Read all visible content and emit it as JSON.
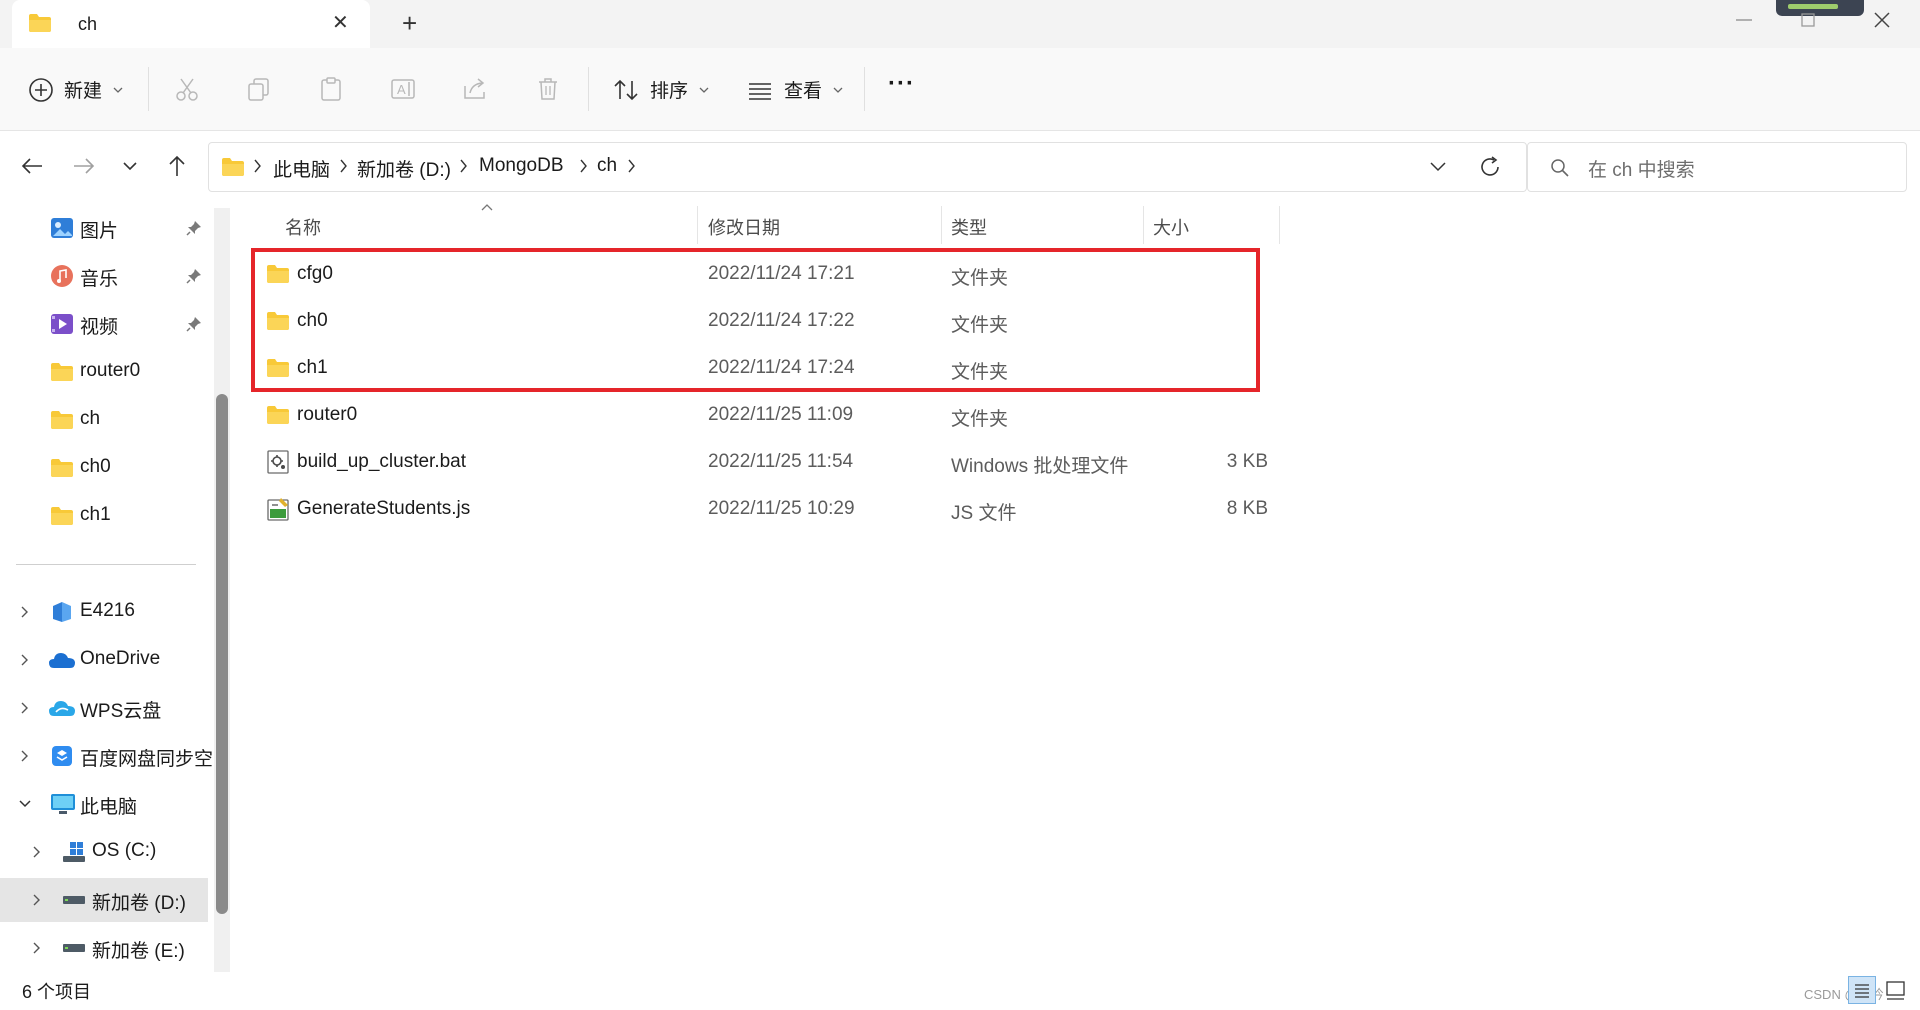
{
  "window": {
    "tab_title": "ch",
    "new_tab_symbol": "+",
    "close_tab_symbol": "✕"
  },
  "toolbar": {
    "new_label": "新建",
    "sort_label": "排序",
    "view_label": "查看",
    "more_label": "···"
  },
  "address": {
    "crumbs": [
      "此电脑",
      "新加卷 (D:)",
      "MongoDB",
      "ch"
    ]
  },
  "search": {
    "placeholder": "在 ch 中搜索"
  },
  "nav": {
    "quick": [
      {
        "label": "图片",
        "icon": "pictures-icon",
        "pinned": true
      },
      {
        "label": "音乐",
        "icon": "music-icon",
        "pinned": true
      },
      {
        "label": "视频",
        "icon": "videos-icon",
        "pinned": true
      },
      {
        "label": "router0",
        "icon": "folder-icon",
        "pinned": false
      },
      {
        "label": "ch",
        "icon": "folder-icon",
        "pinned": false
      },
      {
        "label": "ch0",
        "icon": "folder-icon",
        "pinned": false
      },
      {
        "label": "ch1",
        "icon": "folder-icon",
        "pinned": false
      }
    ],
    "tree": [
      {
        "label": "E4216",
        "icon": "cloud-folder-icon"
      },
      {
        "label": "OneDrive",
        "icon": "onedrive-icon"
      },
      {
        "label": "WPS云盘",
        "icon": "wps-cloud-icon"
      },
      {
        "label": "百度网盘同步空",
        "icon": "baidu-netdisk-icon"
      },
      {
        "label": "此电脑",
        "icon": "this-pc-icon"
      },
      {
        "label": "OS (C:)",
        "icon": "windows-drive-icon"
      },
      {
        "label": "新加卷 (D:)",
        "icon": "drive-icon"
      },
      {
        "label": "新加卷 (E:)",
        "icon": "drive-icon"
      }
    ]
  },
  "columns": {
    "name": "名称",
    "modified": "修改日期",
    "type": "类型",
    "size": "大小"
  },
  "files": [
    {
      "name": "cfg0",
      "modified": "2022/11/24 17:21",
      "type": "文件夹",
      "size": "",
      "icon": "folder-icon"
    },
    {
      "name": "ch0",
      "modified": "2022/11/24 17:22",
      "type": "文件夹",
      "size": "",
      "icon": "folder-icon"
    },
    {
      "name": "ch1",
      "modified": "2022/11/24 17:24",
      "type": "文件夹",
      "size": "",
      "icon": "folder-icon"
    },
    {
      "name": "router0",
      "modified": "2022/11/25 11:09",
      "type": "文件夹",
      "size": "",
      "icon": "folder-icon"
    },
    {
      "name": "build_up_cluster.bat",
      "modified": "2022/11/25 11:54",
      "type": "Windows 批处理文件",
      "size": "3 KB",
      "icon": "batch-file-icon"
    },
    {
      "name": "GenerateStudents.js",
      "modified": "2022/11/25 10:29",
      "type": "JS 文件",
      "size": "8 KB",
      "icon": "js-file-icon"
    }
  ],
  "status": {
    "item_count": "6 个项目"
  },
  "watermark": "CSDN @星吟",
  "colors": {
    "folder": "#f8c938",
    "highlight": "#e5252a",
    "selected_nav": "#e5e5e5"
  }
}
